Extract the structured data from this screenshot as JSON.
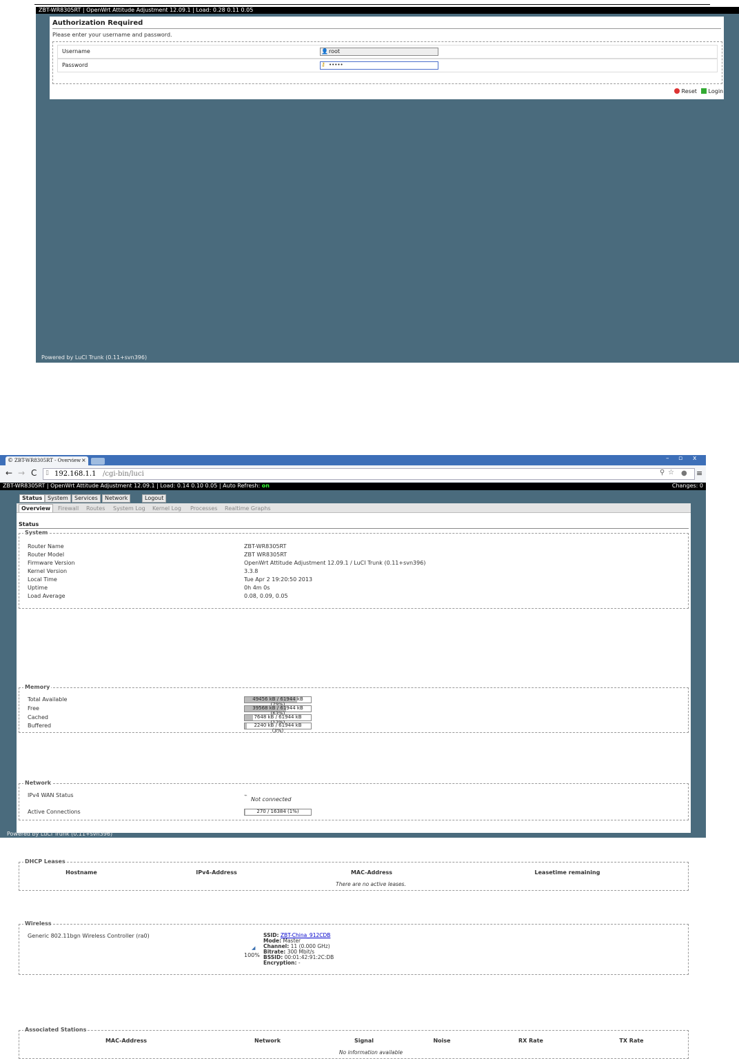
{
  "login": {
    "topbar": "ZBT-WR8305RT | OpenWrt Attitude Adjustment 12.09.1 | Load: 0.28 0.11 0.05",
    "title": "Authorization Required",
    "description": "Please enter your username and password.",
    "username_label": "Username",
    "username_value": "root",
    "password_label": "Password",
    "password_value": "•••••",
    "reset_label": "Reset",
    "login_label": "Login",
    "footer": "Powered by LuCI Trunk (0.11+svn396)",
    "colors": {
      "background": "#4a6b7d",
      "reset_icon": "#d33",
      "login_icon": "#3a3"
    }
  },
  "browser": {
    "tab_title": "ZBT-WR8305RT - Overview",
    "url_host": "192.168.1.1",
    "url_path": "/cgi-bin/luci",
    "win_min": "–",
    "win_max": "▫",
    "win_close": "x"
  },
  "overview": {
    "topbar": "ZBT-WR8305RT | OpenWrt Attitude Adjustment 12.09.1 | Load: 0.14 0.10 0.05 | Auto Refresh:",
    "auto_refresh": "on",
    "changes": "Changes: 0",
    "main_tabs": [
      "Status",
      "System",
      "Services",
      "Network",
      "Logout"
    ],
    "sub_tabs": [
      "Overview",
      "Firewall",
      "Routes",
      "System Log",
      "Kernel Log",
      "Processes",
      "Realtime Graphs"
    ],
    "section_title": "Status",
    "system": {
      "legend": "System",
      "rows": [
        {
          "label": "Router Name",
          "value": "ZBT-WR8305RT"
        },
        {
          "label": "Router Model",
          "value": "ZBT WR8305RT"
        },
        {
          "label": "Firmware Version",
          "value": "OpenWrt Attitude Adjustment 12.09.1 / LuCI Trunk (0.11+svn396)"
        },
        {
          "label": "Kernel Version",
          "value": "3.3.8"
        },
        {
          "label": "Local Time",
          "value": "Tue Apr 2 19:20:50 2013"
        },
        {
          "label": "Uptime",
          "value": "0h 4m 0s"
        },
        {
          "label": "Load Average",
          "value": "0.08, 0.09, 0.05"
        }
      ]
    },
    "memory": {
      "legend": "Memory",
      "rows": [
        {
          "label": "Total Available",
          "text": "49456 kB / 61944 kB",
          "pct": "(79%)",
          "fraction": 0.79
        },
        {
          "label": "Free",
          "text": "39568 kB / 61944 kB",
          "pct": "(63%)",
          "fraction": 0.63
        },
        {
          "label": "Cached",
          "text": "7648 kB / 61944 kB",
          "pct": "(12%)",
          "fraction": 0.12
        },
        {
          "label": "Buffered",
          "text": "2240 kB / 61944 kB",
          "pct": "(3%)",
          "fraction": 0.03
        }
      ]
    },
    "network": {
      "legend": "Network",
      "wan_label": "IPv4 WAN Status",
      "wan_value": "Not connected",
      "conn_label": "Active Connections",
      "conn_text": "270 / 16384 (1%)",
      "conn_fraction": 0.01
    },
    "dhcp": {
      "legend": "DHCP Leases",
      "columns": [
        "Hostname",
        "IPv4-Address",
        "MAC-Address",
        "Leasetime remaining"
      ],
      "empty": "There are no active leases."
    },
    "wireless": {
      "legend": "Wireless",
      "device": "Generic 802.11bgn Wireless Controller (ra0)",
      "signal": "100%",
      "ssid_label": "SSID:",
      "ssid_value": "ZBT-China_912CDB",
      "mode_label": "Mode:",
      "mode_value": "Master",
      "channel_label": "Channel:",
      "channel_value": "11 (0.000 GHz)",
      "bitrate_label": "Bitrate:",
      "bitrate_value": "300 Mbit/s",
      "bssid_label": "BSSID:",
      "bssid_value": "00:01:42:91:2C:DB",
      "enc_label": "Encryption:",
      "enc_value": "-"
    },
    "stations": {
      "legend": "Associated Stations",
      "columns": [
        "MAC-Address",
        "Network",
        "Signal",
        "Noise",
        "RX Rate",
        "TX Rate"
      ],
      "empty": "No information available"
    },
    "footer": "Powered by LuCI Trunk (0.11+svn396)"
  }
}
